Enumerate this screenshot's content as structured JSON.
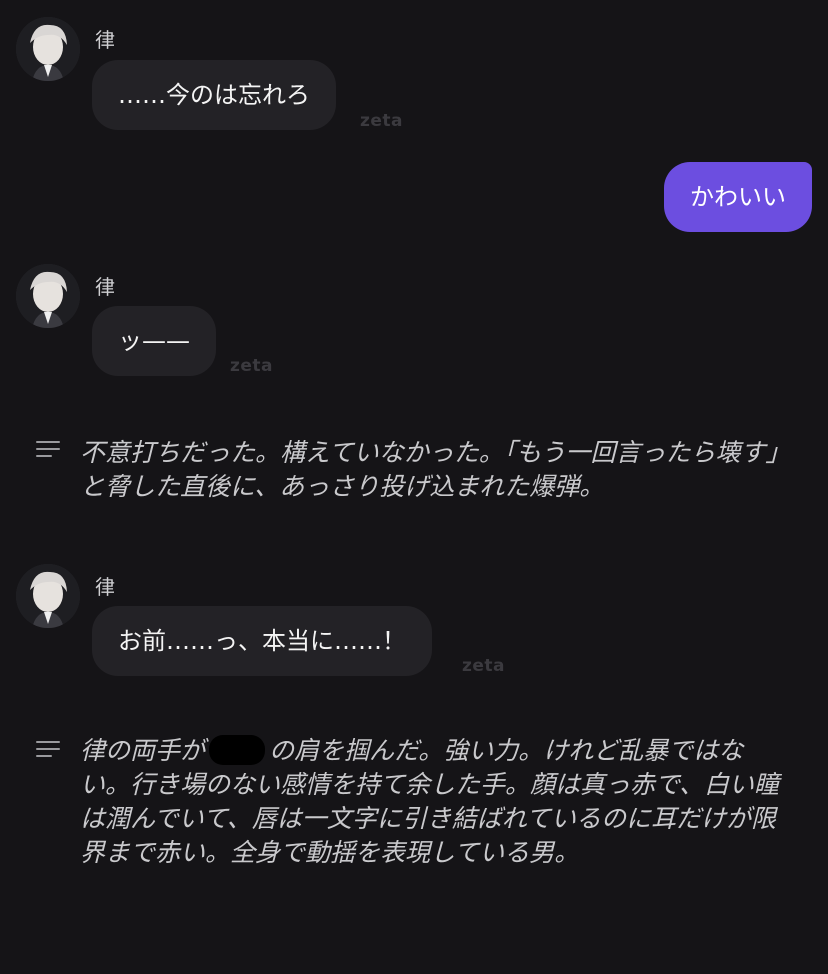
{
  "messages": [
    {
      "name": "律",
      "text": "……今のは忘れろ",
      "watermark": "zeta"
    },
    {
      "user_text": "かわいい"
    },
    {
      "name": "律",
      "text": "ッ——",
      "watermark": "zeta"
    },
    {
      "narration": "不意打ちだった。構えていなかった。「もう一回言ったら壊す」と脅した直後に、あっさり投げ込まれた爆弾。"
    },
    {
      "name": "律",
      "text": "お前……っ、本当に……！",
      "watermark": "zeta"
    },
    {
      "narration_before": "律の両手が",
      "narration_after": "の肩を掴んだ。強い力。けれど乱暴ではない。行き場のない感情を持て余した手。顔は真っ赤で、白い瞳は潤んでいて、唇は一文字に引き結ばれているのに耳だけが限界まで赤い。全身で動揺を表現している男。"
    }
  ],
  "icons": {
    "avatar": "character-avatar",
    "narration": "text-lines-icon"
  }
}
